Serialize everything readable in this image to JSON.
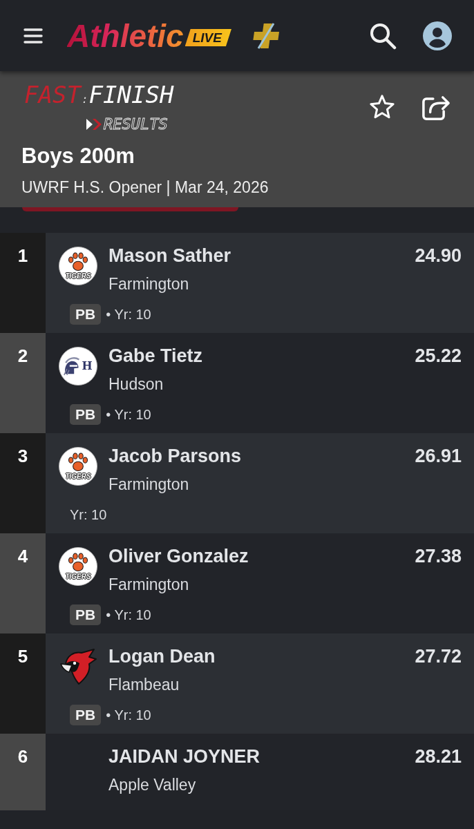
{
  "app_bar": {
    "logo": {
      "wordmark": "Athletic",
      "badge": "LIVE"
    }
  },
  "event": {
    "brand": {
      "word_1": "FAST",
      "separator": ":",
      "word_2": "FINISH",
      "tagline": "RESULTS"
    },
    "favorite": {
      "on": false
    },
    "title": "Boys 200m",
    "subtitle": "UWRF H.S. Opener | Mar 24, 2026"
  },
  "results": [
    {
      "place": "1",
      "logo": {
        "kind": "paw",
        "text": "TIGERS"
      },
      "name": "Mason Sather",
      "team": "Farmington",
      "mark": "24.90",
      "badge": "PB",
      "details": "• Yr: 10"
    },
    {
      "place": "2",
      "logo": {
        "kind": "helmet",
        "text": "H"
      },
      "name": "Gabe Tietz",
      "team": "Hudson",
      "mark": "25.22",
      "badge": "PB",
      "details": "• Yr: 10"
    },
    {
      "place": "3",
      "logo": {
        "kind": "paw",
        "text": "TIGERS"
      },
      "name": "Jacob Parsons",
      "team": "Farmington",
      "mark": "26.91",
      "details": "Yr: 10"
    },
    {
      "place": "4",
      "logo": {
        "kind": "paw",
        "text": "TIGERS"
      },
      "name": "Oliver Gonzalez",
      "team": "Farmington",
      "mark": "27.38",
      "badge": "PB",
      "details": "• Yr: 10"
    },
    {
      "place": "5",
      "logo": {
        "kind": "bird"
      },
      "name": "Logan Dean",
      "team": "Flambeau",
      "mark": "27.72",
      "badge": "PB",
      "details": "• Yr: 10"
    },
    {
      "place": "6",
      "name": "JAIDAN JOYNER",
      "team": "Apple Valley",
      "mark": "28.21"
    }
  ]
}
